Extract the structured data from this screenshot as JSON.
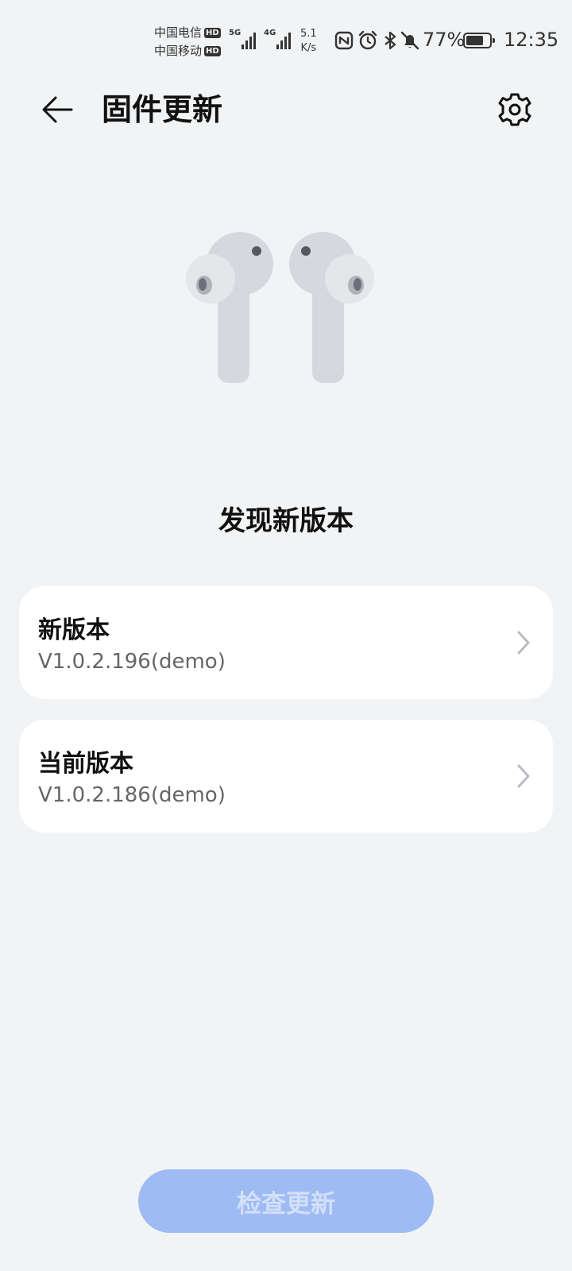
{
  "status_bar": {
    "carrier1": "中国电信",
    "carrier2": "中国移动",
    "hd": "HD",
    "sig1_tag": "5G",
    "sig2_tag": "4G",
    "net_speed_value": "5.1",
    "net_speed_unit": "K/s",
    "icons": [
      "nfc-icon",
      "alarm-icon",
      "bluetooth-icon",
      "mute-icon"
    ],
    "battery_percent": "77%",
    "battery_level": 0.77,
    "time": "12:35"
  },
  "header": {
    "title": "固件更新",
    "back_icon": "arrow-left-icon",
    "settings_icon": "gear-icon"
  },
  "main": {
    "heading": "发现新版本",
    "cards": [
      {
        "label": "新版本",
        "value": "V1.0.2.196(demo)"
      },
      {
        "label": "当前版本",
        "value": "V1.0.2.186(demo)"
      }
    ]
  },
  "footer": {
    "check_button_label": "检查更新"
  },
  "colors": {
    "background": "#f1f3f5",
    "card": "#ffffff",
    "button_disabled": "#9fbbf3",
    "button_text": "#d3e0fa"
  }
}
